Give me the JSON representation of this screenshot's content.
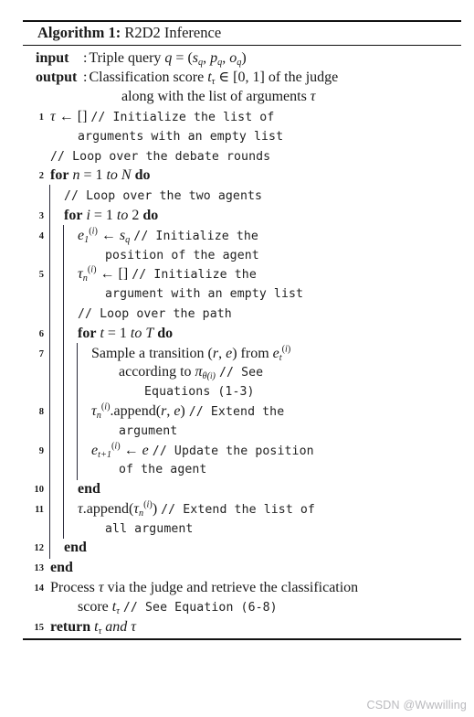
{
  "document": {
    "type": "algorithm-pseudocode",
    "title_keyword": "Algorithm 1:",
    "title_name": "R2D2 Inference"
  },
  "io": {
    "input_label": "input",
    "input_colon": ":",
    "input_text": "Triple query q = (sq, pq, oq)",
    "output_label": "output",
    "output_colon": ":",
    "output_text": "Classification score tτ ∈ [0, 1] of the judge",
    "output_text_cont": "along with the list of arguments τ"
  },
  "lines": [
    {
      "num": "1",
      "code": "τ ← [] // Initialize the list of",
      "cont": "arguments with an empty list"
    },
    {
      "num": "",
      "code": "// Loop over the debate rounds"
    },
    {
      "num": "2",
      "code": "for n = 1 to N do"
    },
    {
      "num": "",
      "code": "// Loop over the two agents"
    },
    {
      "num": "3",
      "code": "for i = 1 to 2 do"
    },
    {
      "num": "4",
      "code": "e1(i) ← sq // Initialize the",
      "cont": "position of the agent"
    },
    {
      "num": "5",
      "code": "τn(i) ← [] // Initialize the",
      "cont": "argument with an empty list"
    },
    {
      "num": "",
      "code": "// Loop over the path"
    },
    {
      "num": "6",
      "code": "for t = 1 to T do"
    },
    {
      "num": "7",
      "code": "Sample a transition (r, e) from et(i)",
      "cont": "according to πθ(i) // See",
      "cont2": "Equations (1-3)"
    },
    {
      "num": "8",
      "code": "τn(i).append(r, e) // Extend the",
      "cont": "argument"
    },
    {
      "num": "9",
      "code": "et+1(i) ← e // Update the position",
      "cont": "of the agent"
    },
    {
      "num": "10",
      "code": "end"
    },
    {
      "num": "11",
      "code": "τ.append(τn(i)) // Extend the list of",
      "cont": "all argument"
    },
    {
      "num": "12",
      "code": "end"
    },
    {
      "num": "13",
      "code": "end"
    },
    {
      "num": "14",
      "code": "Process τ via the judge and retrieve the classification",
      "cont": "score tτ // See Equation (6-8)"
    },
    {
      "num": "15",
      "code": "return tτ and τ"
    }
  ],
  "keywords": {
    "for": "for",
    "do": "do",
    "to": "to",
    "end": "end",
    "return": "return",
    "and": "and"
  },
  "comments": {
    "c1a": "// Initialize the list of",
    "c1b": "arguments with an empty list",
    "c2": "// Loop over the debate rounds",
    "c3": "// Loop over the two agents",
    "c4a": "// Initialize the",
    "c4b": "position of the agent",
    "c5a": "// Initialize the",
    "c5b": "argument with an empty list",
    "c6": "// Loop over the path",
    "c7a": "// See",
    "c7b": "Equations (1-3)",
    "c8a": "// Extend the",
    "c8b": "argument",
    "c9a": "// Update the position",
    "c9b": "of the agent",
    "c11a": "// Extend the list of",
    "c11b": "all argument",
    "c14": "// See Equation (6-8)"
  },
  "watermark": {
    "text": "CSDN @Wwwilling"
  },
  "colors": {
    "rule": "#111111",
    "text": "#1a1a1a",
    "comment": "#222222",
    "bar": "#2a2a3a",
    "watermark": "#b9b9bd",
    "background": "#ffffff"
  }
}
